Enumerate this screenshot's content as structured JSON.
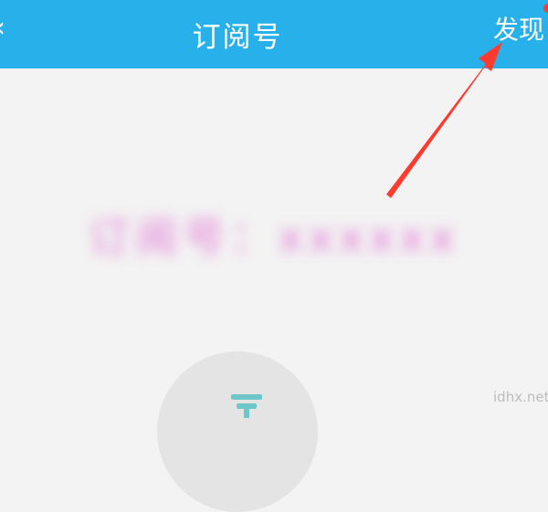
{
  "header": {
    "back_icon": "chevron-left-icon",
    "title": "订阅号",
    "discover_label": "发现",
    "background_color": "#27b0ea"
  },
  "content": {
    "blurred_text": "订阅号：xxxxxx",
    "avatar_icon": "subscription-icon"
  },
  "annotation": {
    "arrow_color": "#ff3b30"
  },
  "watermark": "idhx.net"
}
